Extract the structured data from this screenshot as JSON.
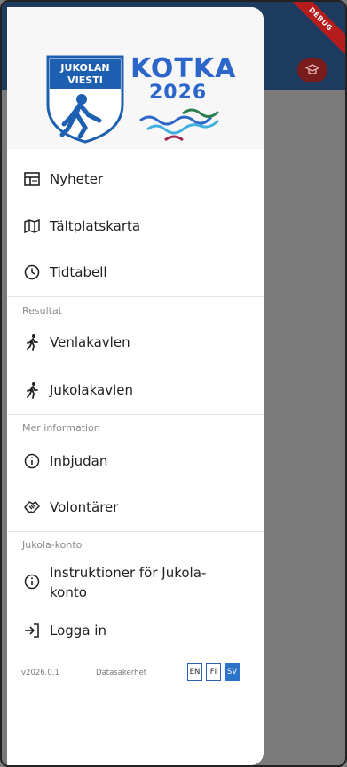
{
  "appbar": {
    "debug_label": "DEBUG"
  },
  "logo": {
    "emblem_line1": "JUKOLAN",
    "emblem_line2": "VIESTI",
    "city": "KOTKA",
    "year": "2026"
  },
  "nav": {
    "news": "Nyheter",
    "tent_map": "Tältplatskarta",
    "schedule": "Tidtabell"
  },
  "sections": {
    "results": "Resultat",
    "more_info": "Mer information",
    "account": "Jukola-konto"
  },
  "results": {
    "venla": "Venlakavlen",
    "jukola": "Jukolakavlen"
  },
  "info": {
    "invitation": "Inbjudan",
    "volunteers": "Volontärer"
  },
  "account": {
    "instructions_line1": "Instruktioner för Jukola-",
    "instructions_line2": "konto",
    "login": "Logga in"
  },
  "footer": {
    "version": "v2026.0.1",
    "privacy": "Datasäkerhet",
    "languages": [
      "EN",
      "FI",
      "SV"
    ],
    "active_language": "SV"
  },
  "colors": {
    "appbar": "#1d3a5f",
    "accent": "#2c66c9",
    "debug": "#b71c1c"
  }
}
